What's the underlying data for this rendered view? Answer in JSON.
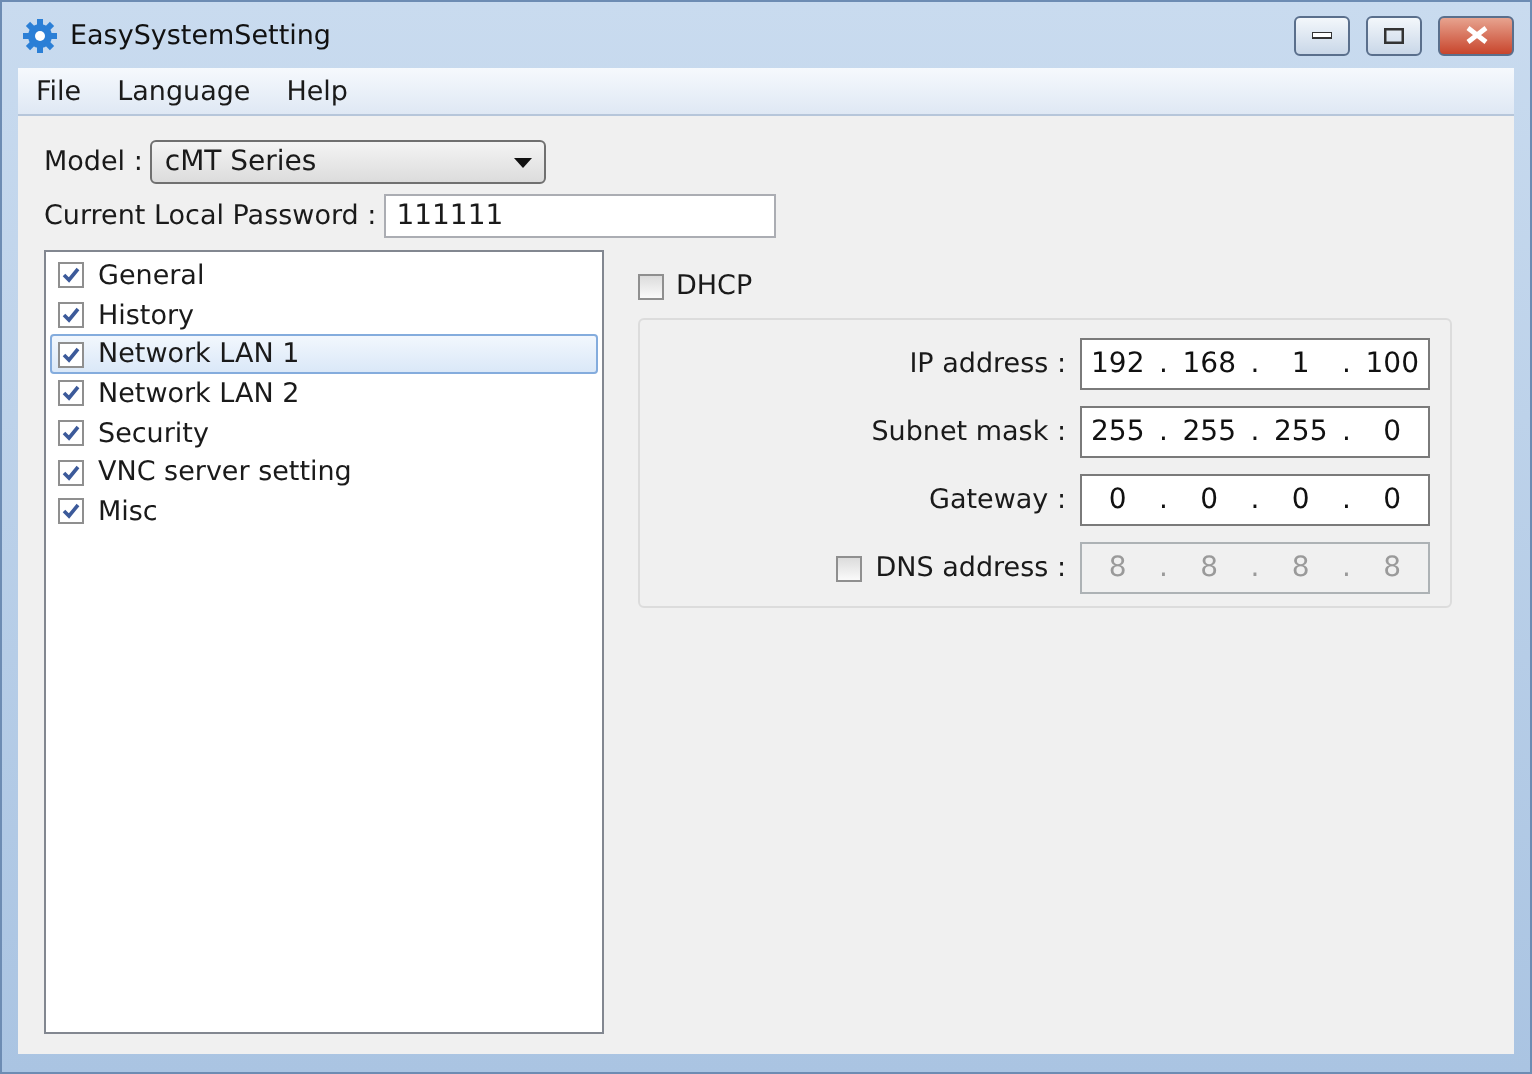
{
  "window": {
    "title": "EasySystemSetting"
  },
  "menu": [
    "File",
    "Language",
    "Help"
  ],
  "model": {
    "label": "Model :",
    "value": "cMT Series"
  },
  "password": {
    "label": "Current Local Password :",
    "value": "111111"
  },
  "categories": [
    {
      "label": "General",
      "checked": true,
      "selected": false
    },
    {
      "label": "History",
      "checked": true,
      "selected": false
    },
    {
      "label": "Network LAN 1",
      "checked": true,
      "selected": true
    },
    {
      "label": "Network LAN 2",
      "checked": true,
      "selected": false
    },
    {
      "label": "Security",
      "checked": true,
      "selected": false
    },
    {
      "label": "VNC server setting",
      "checked": true,
      "selected": false
    },
    {
      "label": "Misc",
      "checked": true,
      "selected": false
    }
  ],
  "dhcp": {
    "label": "DHCP",
    "checked": false
  },
  "separator": ".",
  "addresses": [
    {
      "kind": "plain",
      "label": "IP address :",
      "octets": [
        "192",
        "168",
        "1",
        "100"
      ],
      "disabled": false
    },
    {
      "kind": "plain",
      "label": "Subnet mask :",
      "octets": [
        "255",
        "255",
        "255",
        "0"
      ],
      "disabled": false
    },
    {
      "kind": "plain",
      "label": "Gateway :",
      "octets": [
        "0",
        "0",
        "0",
        "0"
      ],
      "disabled": false
    },
    {
      "kind": "checkbox",
      "label": "DNS address :",
      "checked": false,
      "octets": [
        "8",
        "8",
        "8",
        "8"
      ],
      "disabled": true
    }
  ]
}
